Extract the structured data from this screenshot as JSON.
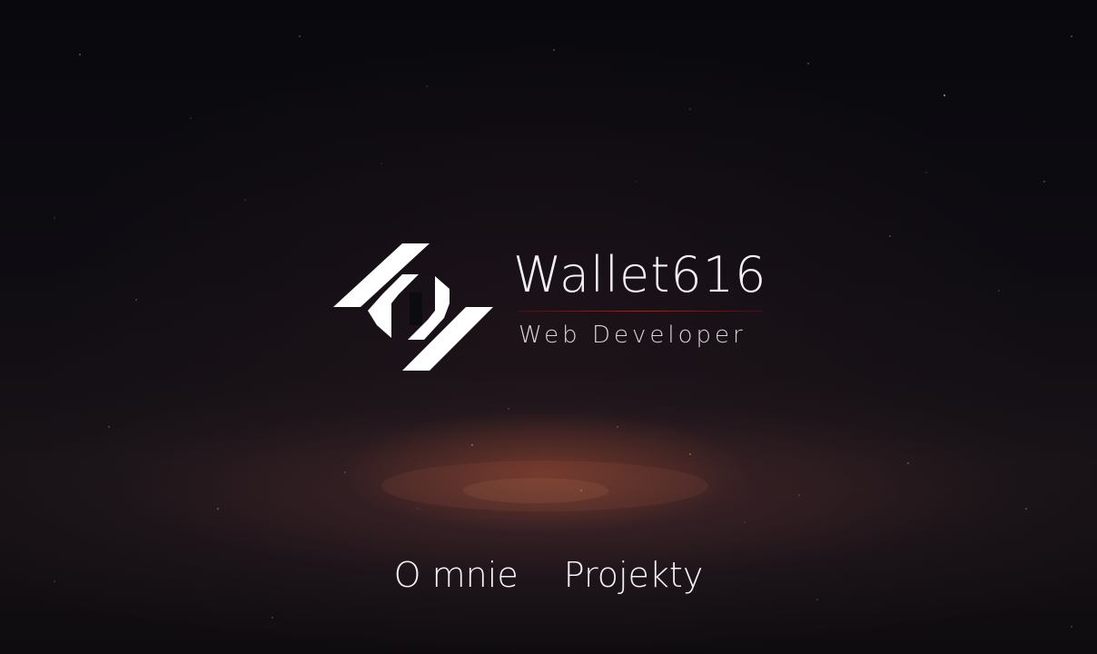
{
  "brand": {
    "name": "Wallet616",
    "tagline": "Web Developer",
    "logo_icon": "wallet616-logo-icon"
  },
  "nav": {
    "items": [
      {
        "label": "O mnie"
      },
      {
        "label": "Projekty"
      }
    ]
  },
  "colors": {
    "background": "#0c0b10",
    "text": "#f2f0f2",
    "accent_rule": "#8d2a2a"
  }
}
